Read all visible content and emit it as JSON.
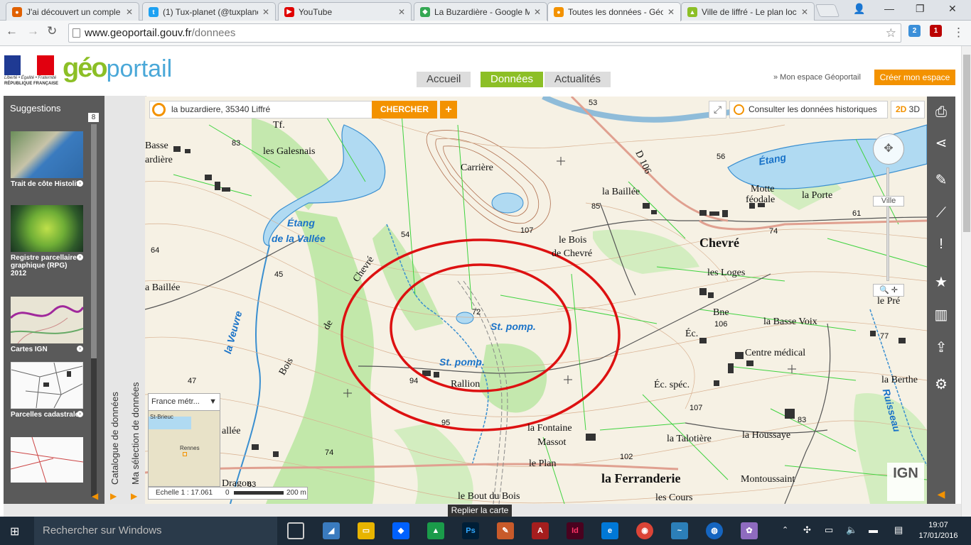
{
  "browser": {
    "tabs": [
      {
        "label": "J'ai découvert un comple",
        "favicon": "globe-icon",
        "color": "#e06000"
      },
      {
        "label": "(1) Tux-planet (@tuxplane",
        "favicon": "twitter-icon",
        "color": "#1da1f2"
      },
      {
        "label": "YouTube",
        "favicon": "youtube-icon",
        "color": "#e00000"
      },
      {
        "label": "La Buzardière - Google M",
        "favicon": "maps-icon",
        "color": "#34a853"
      },
      {
        "label": "Toutes les données - Géo",
        "favicon": "geoportail-icon",
        "color": "#f39200",
        "active": true
      },
      {
        "label": "Ville de liffré - Le plan loc",
        "favicon": "city-icon",
        "color": "#8cbf26"
      }
    ],
    "url_host": "www.geoportail.gouv.fr",
    "url_path": "/donnees",
    "ext_badges": [
      "2",
      "1"
    ]
  },
  "header": {
    "republic": {
      "line1": "Liberté • Égalité • Fraternité",
      "line2": "RÉPUBLIQUE FRANÇAISE"
    },
    "logo": {
      "geo": "géo",
      "portail": "portail"
    },
    "nav": [
      {
        "label": "Accueil",
        "active": false
      },
      {
        "label": "Données",
        "active": true
      },
      {
        "label": "Actualités",
        "active": false
      }
    ],
    "espace": "» Mon espace Géoportail",
    "create": "Créer mon espace"
  },
  "sidebar": {
    "title": "Suggestions",
    "count": "8",
    "items": [
      {
        "label": "Trait de côte Histolitt"
      },
      {
        "label": "Registre parcellaire graphique (RPG) 2012"
      },
      {
        "label": "Cartes IGN"
      },
      {
        "label": "Parcelles cadastrales"
      }
    ],
    "catalogue_tab": "Catalogue de données",
    "selection_tab": "Ma sélection de données"
  },
  "map": {
    "search_value": "la buzardiere, 35340 Liffré",
    "search_button": "CHERCHER",
    "plus_button": "+",
    "history_button": "Consulter les données historiques",
    "mode_2d": "2D",
    "mode_3d": "3D",
    "zoom_label": "Ville",
    "minimap_select": "France métr...",
    "minimap_cities": [
      "St-Brieuc",
      "Rennes"
    ],
    "scale_text": "Echelle 1 : 17.061",
    "scale_bar": [
      "0",
      "200 m"
    ],
    "ign_logo": "IGN",
    "labels": [
      {
        "text": "Tf.",
        "cls": "",
        "name": "tf"
      },
      {
        "text": "Basse",
        "cls": "",
        "name": "basse"
      },
      {
        "text": "ardière",
        "cls": "",
        "name": "ardiere"
      },
      {
        "text": "83",
        "cls": "num",
        "name": "alt-83"
      },
      {
        "text": "les Galesnais",
        "cls": "",
        "name": "galesnais"
      },
      {
        "text": "Carrière",
        "cls": "",
        "name": "carriere"
      },
      {
        "text": "53",
        "cls": "num",
        "name": "alt-53"
      },
      {
        "text": "D 106",
        "cls": "",
        "name": "d106"
      },
      {
        "text": "la Baillée",
        "cls": "",
        "name": "baillee"
      },
      {
        "text": "85",
        "cls": "num",
        "name": "alt-85"
      },
      {
        "text": "56",
        "cls": "num",
        "name": "alt-56"
      },
      {
        "text": "Étang",
        "cls": "blue",
        "name": "etang"
      },
      {
        "text": "Motte",
        "cls": "",
        "name": "motte"
      },
      {
        "text": "féodale",
        "cls": "",
        "name": "feodale"
      },
      {
        "text": "la Porte",
        "cls": "",
        "name": "porte"
      },
      {
        "text": "61",
        "cls": "num",
        "name": "alt-61"
      },
      {
        "text": "Étang",
        "cls": "blue",
        "name": "etang-vallee-1"
      },
      {
        "text": "de la Vallée",
        "cls": "blue",
        "name": "etang-vallee-2"
      },
      {
        "text": "54",
        "cls": "num",
        "name": "alt-54"
      },
      {
        "text": "107",
        "cls": "num",
        "name": "alt-107"
      },
      {
        "text": "le Bois",
        "cls": "",
        "name": "lebois"
      },
      {
        "text": "de Chevré",
        "cls": "",
        "name": "dechevre"
      },
      {
        "text": "Chevré",
        "cls": "big",
        "name": "chevre"
      },
      {
        "text": "74",
        "cls": "num",
        "name": "alt-74"
      },
      {
        "text": "64",
        "cls": "num",
        "name": "alt-64"
      },
      {
        "text": "45",
        "cls": "num",
        "name": "alt-45"
      },
      {
        "text": "a Baillée",
        "cls": "",
        "name": "a-baillee"
      },
      {
        "text": "les Loges",
        "cls": "",
        "name": "loges"
      },
      {
        "text": "72",
        "cls": "num",
        "name": "alt-72"
      },
      {
        "text": "St. pomp.",
        "cls": "blue",
        "name": "stpomp1"
      },
      {
        "text": "Bne",
        "cls": "",
        "name": "bne"
      },
      {
        "text": "106",
        "cls": "num",
        "name": "alt-106"
      },
      {
        "text": "la Basse Voix",
        "cls": "",
        "name": "bassevoix"
      },
      {
        "text": "le Pré",
        "cls": "",
        "name": "lepre"
      },
      {
        "text": "Éc.",
        "cls": "",
        "name": "ec"
      },
      {
        "text": "77",
        "cls": "num",
        "name": "alt-77"
      },
      {
        "text": "Centre médical",
        "cls": "",
        "name": "centre"
      },
      {
        "text": "St. pomp.",
        "cls": "blue",
        "name": "stpomp2"
      },
      {
        "text": "94",
        "cls": "num",
        "name": "alt-94"
      },
      {
        "text": "Rallion",
        "cls": "",
        "name": "rallion"
      },
      {
        "text": "Éc. spéc.",
        "cls": "",
        "name": "ecspec"
      },
      {
        "text": "la Berthe",
        "cls": "",
        "name": "berthe"
      },
      {
        "text": "47",
        "cls": "num",
        "name": "alt-47"
      },
      {
        "text": "Bois",
        "cls": "",
        "name": "bois"
      },
      {
        "text": "de",
        "cls": "",
        "name": "de"
      },
      {
        "text": "Chevré",
        "cls": "",
        "name": "chevre-bois"
      },
      {
        "text": "la Veuvre",
        "cls": "blue",
        "name": "veuvre"
      },
      {
        "text": "107",
        "cls": "num",
        "name": "alt-107b"
      },
      {
        "text": "83",
        "cls": "num",
        "name": "alt-83b"
      },
      {
        "text": "95",
        "cls": "num",
        "name": "alt-95"
      },
      {
        "text": "la Fontaine",
        "cls": "",
        "name": "fontaine"
      },
      {
        "text": "Massot",
        "cls": "",
        "name": "massot"
      },
      {
        "text": "la Talotière",
        "cls": "",
        "name": "talotiere"
      },
      {
        "text": "la Houssaye",
        "cls": "",
        "name": "houssaye"
      },
      {
        "text": "allée",
        "cls": "",
        "name": "allee"
      },
      {
        "text": "74",
        "cls": "num",
        "name": "alt-74b"
      },
      {
        "text": "102",
        "cls": "num",
        "name": "alt-102"
      },
      {
        "text": "le Plan",
        "cls": "",
        "name": "plan"
      },
      {
        "text": "la Ferranderie",
        "cls": "big",
        "name": "ferranderie"
      },
      {
        "text": "Montoussaint",
        "cls": "",
        "name": "montoussaint"
      },
      {
        "text": "Dragon",
        "cls": "",
        "name": "dragon"
      },
      {
        "text": "63",
        "cls": "num",
        "name": "alt-63"
      },
      {
        "text": "le Bout du Bois",
        "cls": "",
        "name": "boutdubois"
      },
      {
        "text": "les Cours",
        "cls": "",
        "name": "cours"
      },
      {
        "text": "Ruisseau",
        "cls": "blue",
        "name": "ruisseau"
      }
    ]
  },
  "footer": {
    "replier": "Replier la carte"
  },
  "taskbar": {
    "search_placeholder": "Rechercher sur Windows",
    "time": "19:07",
    "date": "17/01/2016"
  },
  "colors": {
    "accent": "#f39200",
    "nav_active": "#8cbf26",
    "annotation": "#dd1111"
  }
}
